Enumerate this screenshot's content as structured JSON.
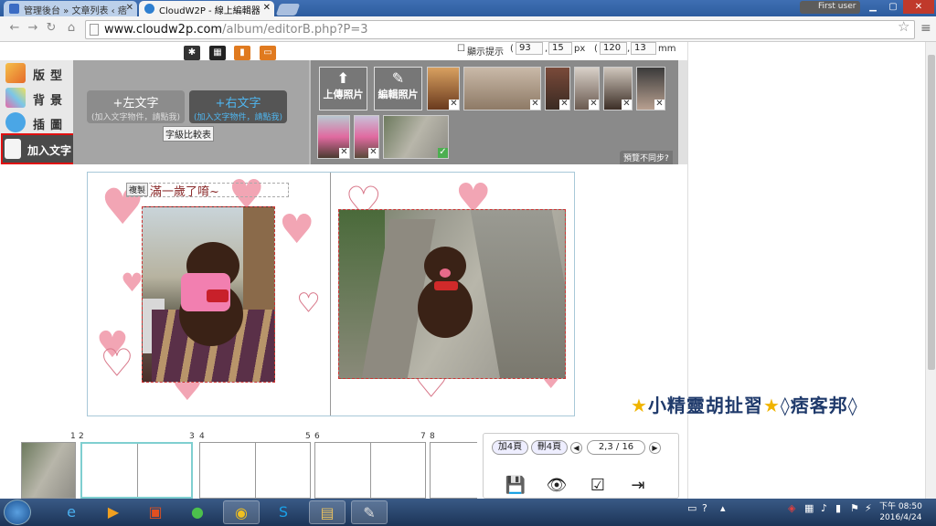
{
  "browser": {
    "tabs": [
      {
        "title": "管理後台 » 文章列表 ‹ 痞",
        "active": false
      },
      {
        "title": "CloudW2P - 線上編輯器",
        "active": true
      }
    ],
    "user": "First user",
    "url_host": "www.cloudw2p.com",
    "url_path": "/album/editorB.php?P=3"
  },
  "editor": {
    "show_hint_label": "顯示提示",
    "pos_x": "93",
    "pos_y": "15",
    "px_unit": "px",
    "size_w": "120",
    "size_h": "13",
    "mm_unit": "mm",
    "menu": [
      {
        "label": "版型",
        "icon": "layout-icon"
      },
      {
        "label": "背景",
        "icon": "background-icon"
      },
      {
        "label": "插圖",
        "icon": "illustration-icon"
      },
      {
        "label": "加入文字",
        "icon": "add-text-icon",
        "selected": true
      }
    ],
    "left_text_btn": "+左文字",
    "left_text_sub": "(加入文字物件，請點我)",
    "right_text_btn": "+右文字",
    "right_text_sub": "(加入文字物件，請點我)",
    "font_compare": "字級比較表",
    "upload_btn": "上傳照片",
    "edit_btn": "編輯照片",
    "preview_mismatch": "預覽不同步?",
    "copy_label": "複製",
    "caption_text": "滿一歲了唷~"
  },
  "pages": {
    "numbers": [
      "1",
      "2",
      "3",
      "4",
      "5",
      "6",
      "7",
      "8"
    ],
    "add_pages": "加4頁",
    "delete_pages": "刪4頁",
    "page_indicator": "2,3 / 16"
  },
  "watermark": {
    "star": "★",
    "text1": "小精靈胡扯習",
    "text2": "◊痞客邦◊"
  },
  "taskbar": {
    "clock_time": "下午 08:50",
    "clock_date": "2016/4/24"
  },
  "colors": {
    "selected_menu_border": "#e01010",
    "accent_blue": "#4fb6f0",
    "heart_pink": "#f2a5b4"
  }
}
